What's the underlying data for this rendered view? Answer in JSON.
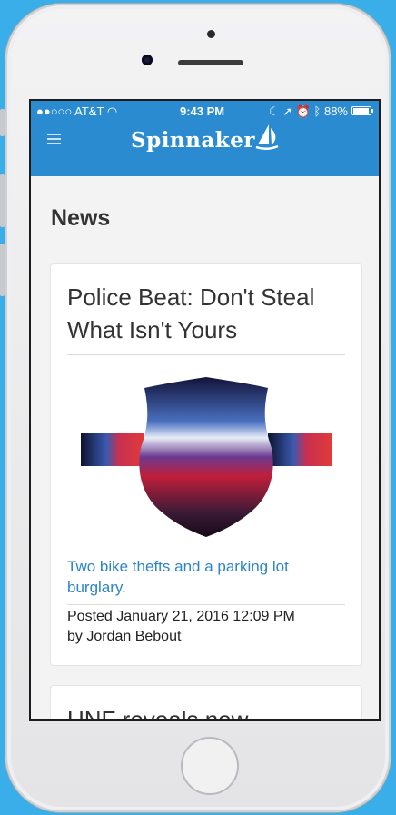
{
  "status_bar": {
    "carrier": "●●○○○ AT&T",
    "time": "9:43 PM",
    "battery": "88%"
  },
  "header": {
    "logo_text": "Spinnaker",
    "menu_icon": "hamburger-icon",
    "brand_color": "#2b8bd1"
  },
  "page": {
    "heading": "News"
  },
  "articles": [
    {
      "title": "Police Beat: Don't Steal What Isn't Yours",
      "summary": "Two bike thefts and a parking lot burglary.",
      "posted": "Posted January 21, 2016 12:09 PM",
      "author": "by Jordan Bebout"
    },
    {
      "title": "UNF reveals new"
    }
  ]
}
